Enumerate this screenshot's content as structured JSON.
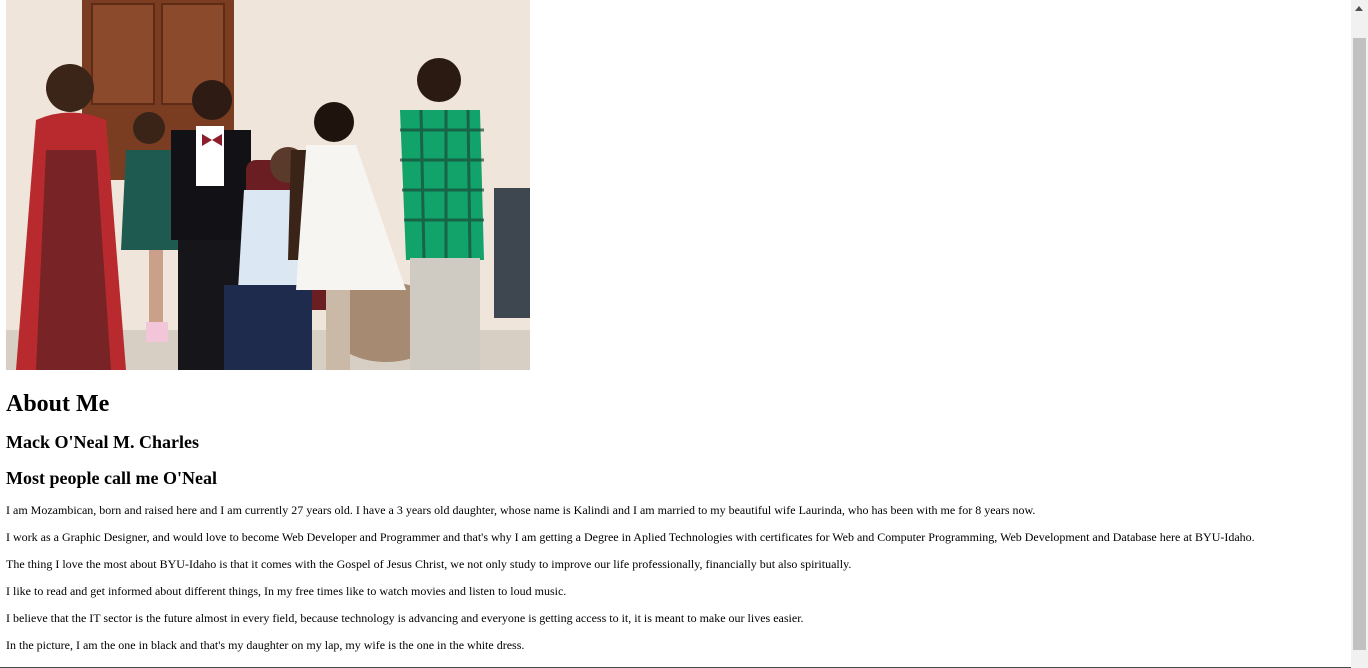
{
  "photo": {
    "alt": "Family photo"
  },
  "about": {
    "heading": "About Me",
    "name": "Mack O'Neal M. Charles",
    "nickname": "Most people call me O'Neal",
    "paragraphs": [
      "I am Mozambican, born and raised here and I am currently 27 years old. I have a 3 years old daughter, whose name is Kalindi and I am married to my beautiful wife Laurinda, who has been with me for 8 years now.",
      "I work as a Graphic Designer, and would love to become Web Developer and Programmer and that's why I am getting a Degree in Aplied Technologies with certificates for Web and Computer Programming, Web Development and Database here at BYU-Idaho.",
      "The thing I love the most about BYU-Idaho is that it comes with the Gospel of Jesus Christ, we not only study to improve our life professionally, financially but also spiritually.",
      "I like to read and get informed about different things, In my free times like to watch movies and listen to loud music.",
      "I believe that the IT sector is the future almost in every field, because technology is advancing and everyone is getting access to it, it is meant to make our lives easier.",
      "In the picture, I am the one in black and that's my daughter on my lap, my wife is the one in the white dress."
    ]
  }
}
